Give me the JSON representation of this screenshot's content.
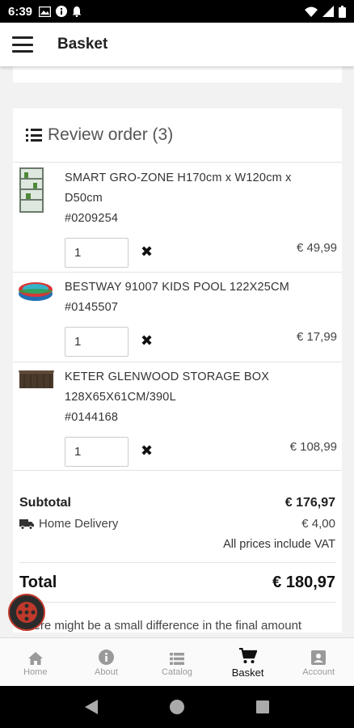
{
  "status_bar": {
    "time": "6:39"
  },
  "app_bar": {
    "title": "Basket"
  },
  "review": {
    "title": "Review order (3)",
    "items": [
      {
        "name_line1": "SMART GRO-ZONE H170cm x W120cm x",
        "name_line2": "D50cm",
        "sku": "#0209254",
        "qty": "1",
        "price": "€ 49,99",
        "thumb_icon": "greenhouse-image"
      },
      {
        "name_line1": "BESTWAY 91007 KIDS POOL 122X25CM",
        "sku": "#0145507",
        "qty": "1",
        "price": "€ 17,99",
        "thumb_icon": "kids-pool-image"
      },
      {
        "name_line1": "KETER GLENWOOD STORAGE BOX",
        "name_line2": "128X65X61CM/390L",
        "sku": "#0144168",
        "qty": "1",
        "price": "€ 108,99",
        "thumb_icon": "storage-box-image"
      }
    ],
    "remove_glyph": "✖"
  },
  "totals": {
    "subtotal_label": "Subtotal",
    "subtotal_value": "€ 176,97",
    "delivery_label": "Home Delivery",
    "delivery_value": "€ 4,00",
    "vat_note": "All prices include VAT",
    "total_label": "Total",
    "total_value": "€ 180,97",
    "difference_note": "There might be a small difference in the final amount"
  },
  "bottom_nav": {
    "items": [
      {
        "label": "Home",
        "icon": "home-icon"
      },
      {
        "label": "About",
        "icon": "info-icon"
      },
      {
        "label": "Catalog",
        "icon": "catalog-icon"
      },
      {
        "label": "Basket",
        "icon": "cart-icon",
        "active": true
      },
      {
        "label": "Account",
        "icon": "account-icon"
      }
    ]
  },
  "colors": {
    "accent": "#c0392b",
    "text": "#222222",
    "muted": "#9a9a9a"
  }
}
